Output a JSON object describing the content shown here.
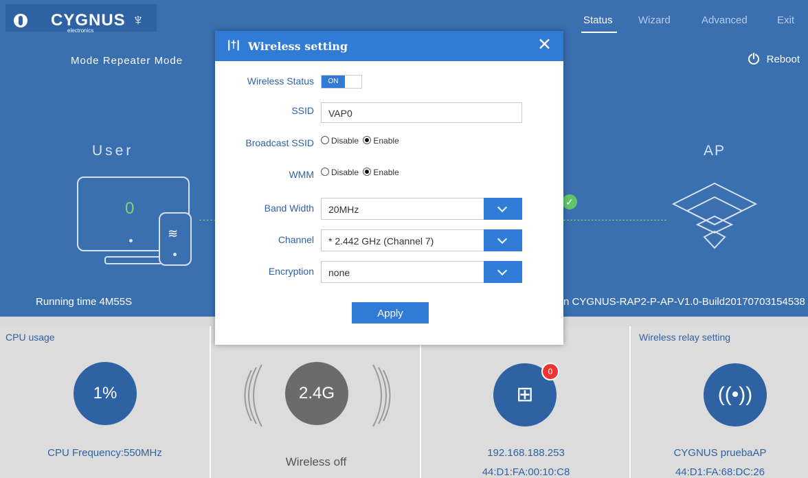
{
  "brand": {
    "logo": "CYGNUS",
    "logo_sub": "electronics",
    "logo_glyph": "♆"
  },
  "nav": [
    {
      "label": "Status",
      "active": true
    },
    {
      "label": "Wizard",
      "active": false
    },
    {
      "label": "Advanced",
      "active": false
    },
    {
      "label": "Exit",
      "active": false
    }
  ],
  "status": {
    "mode": "Mode Repeater Mode",
    "reboot": "Reboot",
    "user_label": "User",
    "ap_label": "AP",
    "user_count": "0",
    "running_time": "Running time 4M55S",
    "version_text": "n CYGNUS-RAP2-P-AP-V1.0-Build20170703154538"
  },
  "panels": {
    "cpu": {
      "title": "CPU usage",
      "value": "1%",
      "caption": "CPU Frequency:550MHz"
    },
    "wireless": {
      "value": "2.4G",
      "caption": "Wireless off"
    },
    "lan": {
      "badge": "0",
      "ip": "192.168.188.253",
      "mac": "44:D1:FA:00:10:C8"
    },
    "relay": {
      "title": "Wireless relay setting",
      "name": "CYGNUS pruebaAP",
      "mac": "44:D1:FA:68:DC:26"
    }
  },
  "modal": {
    "title": "Wireless setting",
    "close": "✕",
    "labels": {
      "wireless_status": "Wireless Status",
      "ssid": "SSID",
      "broadcast_ssid": "Broadcast SSID",
      "wmm": "WMM",
      "band_width": "Band Width",
      "channel": "Channel",
      "encryption": "Encryption"
    },
    "toggle": "ON",
    "ssid_value": "VAP0",
    "radio_disable": "Disable",
    "radio_enable": "Enable",
    "band_width_value": "20MHz",
    "channel_value": "* 2.442 GHz (Channel 7)",
    "encryption_value": "none",
    "apply": "Apply"
  }
}
